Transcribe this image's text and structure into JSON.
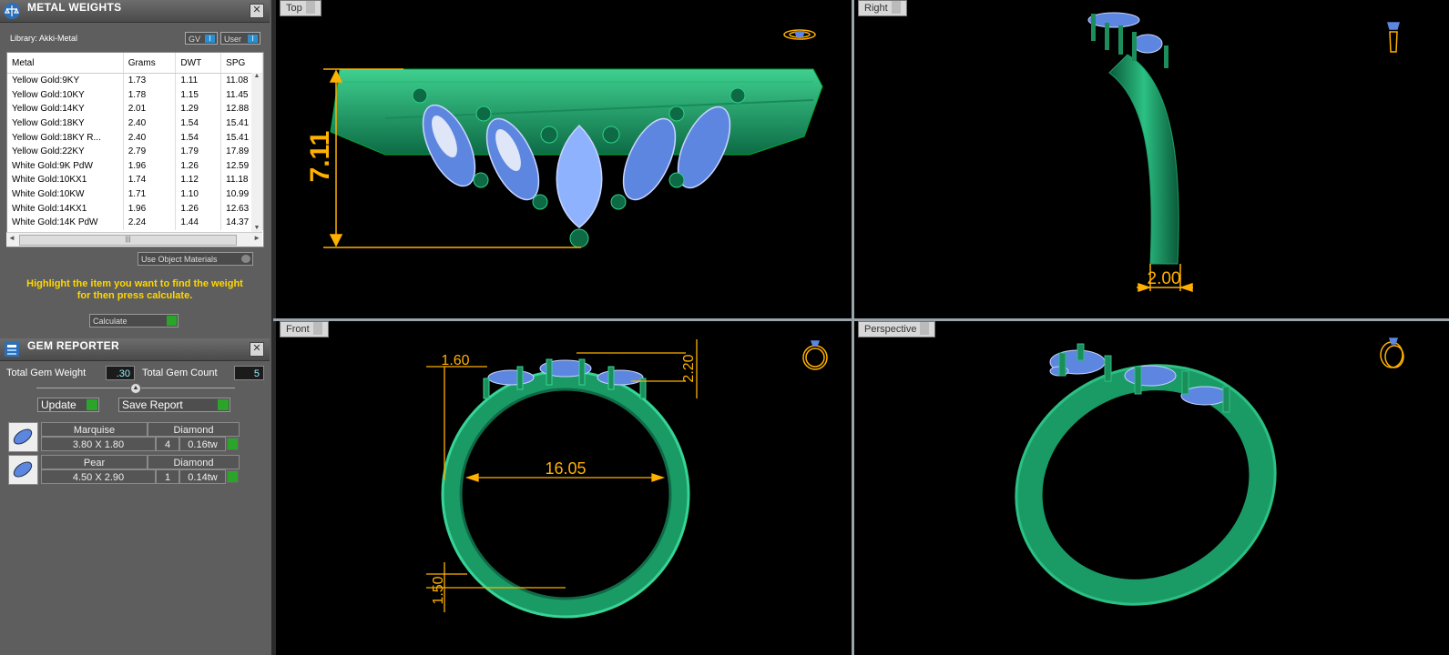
{
  "metal_panel": {
    "title": "METAL WEIGHTS",
    "library": "Library: Akki-Metal",
    "toggle_gv": "GV",
    "toggle_user": "User",
    "columns": [
      "Metal",
      "Grams",
      "DWT",
      "SPG"
    ],
    "rows": [
      [
        "Yellow Gold:9KY",
        "1.73",
        "1.11",
        "11.08"
      ],
      [
        "Yellow Gold:10KY",
        "1.78",
        "1.15",
        "11.45"
      ],
      [
        "Yellow Gold:14KY",
        "2.01",
        "1.29",
        "12.88"
      ],
      [
        "Yellow Gold:18KY",
        "2.40",
        "1.54",
        "15.41"
      ],
      [
        "Yellow Gold:18KY R...",
        "2.40",
        "1.54",
        "15.41"
      ],
      [
        "Yellow Gold:22KY",
        "2.79",
        "1.79",
        "17.89"
      ],
      [
        "White Gold:9K PdW",
        "1.96",
        "1.26",
        "12.59"
      ],
      [
        "White Gold:10KX1",
        "1.74",
        "1.12",
        "11.18"
      ],
      [
        "White Gold:10KW",
        "1.71",
        "1.10",
        "10.99"
      ],
      [
        "White Gold:14KX1",
        "1.96",
        "1.26",
        "12.63"
      ],
      [
        "White Gold:14K PdW",
        "2.24",
        "1.44",
        "14.37"
      ]
    ],
    "use_object_materials": "Use Object Materials",
    "hint_line1": "Highlight the item you want to find the weight",
    "hint_line2": "for then press calculate.",
    "calculate": "Calculate"
  },
  "gem_panel": {
    "title": "GEM REPORTER",
    "total_weight_label": "Total Gem Weight",
    "total_weight_value": ".30",
    "total_count_label": "Total Gem Count",
    "total_count_value": "5",
    "update": "Update",
    "save_report": "Save Report",
    "gems": [
      {
        "shape": "Marquise",
        "material": "Diamond",
        "size": "3.80 X 1.80",
        "count": "4",
        "weight": "0.16tw"
      },
      {
        "shape": "Pear",
        "material": "Diamond",
        "size": "4.50 X 2.90",
        "count": "1",
        "weight": "0.14tw"
      }
    ]
  },
  "viewports": {
    "top": {
      "label": "Top",
      "dims": [
        "7.11"
      ]
    },
    "right": {
      "label": "Right",
      "dims": [
        "2.00"
      ]
    },
    "front": {
      "label": "Front",
      "dims": [
        "1.60",
        "2.20",
        "16.05",
        "1.50"
      ]
    },
    "perspective": {
      "label": "Perspective"
    }
  },
  "colors": {
    "metal_green": "#1f9a6a",
    "gem_blue": "#5d86e0",
    "dimension_orange": "#ffb000",
    "hint_yellow": "#ffd700"
  }
}
